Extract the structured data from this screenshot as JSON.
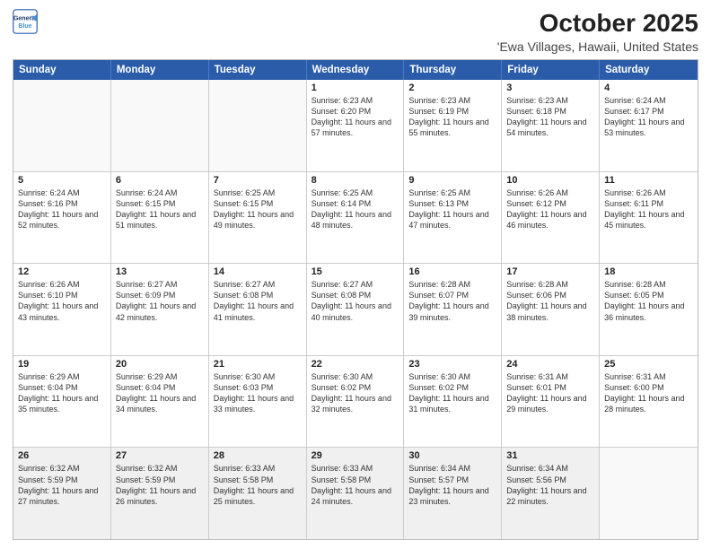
{
  "header": {
    "logo_line1": "General",
    "logo_line2": "Blue",
    "month": "October 2025",
    "location": "'Ewa Villages, Hawaii, United States"
  },
  "weekdays": [
    "Sunday",
    "Monday",
    "Tuesday",
    "Wednesday",
    "Thursday",
    "Friday",
    "Saturday"
  ],
  "rows": [
    [
      {
        "day": "",
        "info": ""
      },
      {
        "day": "",
        "info": ""
      },
      {
        "day": "",
        "info": ""
      },
      {
        "day": "1",
        "info": "Sunrise: 6:23 AM\nSunset: 6:20 PM\nDaylight: 11 hours and 57 minutes."
      },
      {
        "day": "2",
        "info": "Sunrise: 6:23 AM\nSunset: 6:19 PM\nDaylight: 11 hours and 55 minutes."
      },
      {
        "day": "3",
        "info": "Sunrise: 6:23 AM\nSunset: 6:18 PM\nDaylight: 11 hours and 54 minutes."
      },
      {
        "day": "4",
        "info": "Sunrise: 6:24 AM\nSunset: 6:17 PM\nDaylight: 11 hours and 53 minutes."
      }
    ],
    [
      {
        "day": "5",
        "info": "Sunrise: 6:24 AM\nSunset: 6:16 PM\nDaylight: 11 hours and 52 minutes."
      },
      {
        "day": "6",
        "info": "Sunrise: 6:24 AM\nSunset: 6:15 PM\nDaylight: 11 hours and 51 minutes."
      },
      {
        "day": "7",
        "info": "Sunrise: 6:25 AM\nSunset: 6:15 PM\nDaylight: 11 hours and 49 minutes."
      },
      {
        "day": "8",
        "info": "Sunrise: 6:25 AM\nSunset: 6:14 PM\nDaylight: 11 hours and 48 minutes."
      },
      {
        "day": "9",
        "info": "Sunrise: 6:25 AM\nSunset: 6:13 PM\nDaylight: 11 hours and 47 minutes."
      },
      {
        "day": "10",
        "info": "Sunrise: 6:26 AM\nSunset: 6:12 PM\nDaylight: 11 hours and 46 minutes."
      },
      {
        "day": "11",
        "info": "Sunrise: 6:26 AM\nSunset: 6:11 PM\nDaylight: 11 hours and 45 minutes."
      }
    ],
    [
      {
        "day": "12",
        "info": "Sunrise: 6:26 AM\nSunset: 6:10 PM\nDaylight: 11 hours and 43 minutes."
      },
      {
        "day": "13",
        "info": "Sunrise: 6:27 AM\nSunset: 6:09 PM\nDaylight: 11 hours and 42 minutes."
      },
      {
        "day": "14",
        "info": "Sunrise: 6:27 AM\nSunset: 6:08 PM\nDaylight: 11 hours and 41 minutes."
      },
      {
        "day": "15",
        "info": "Sunrise: 6:27 AM\nSunset: 6:08 PM\nDaylight: 11 hours and 40 minutes."
      },
      {
        "day": "16",
        "info": "Sunrise: 6:28 AM\nSunset: 6:07 PM\nDaylight: 11 hours and 39 minutes."
      },
      {
        "day": "17",
        "info": "Sunrise: 6:28 AM\nSunset: 6:06 PM\nDaylight: 11 hours and 38 minutes."
      },
      {
        "day": "18",
        "info": "Sunrise: 6:28 AM\nSunset: 6:05 PM\nDaylight: 11 hours and 36 minutes."
      }
    ],
    [
      {
        "day": "19",
        "info": "Sunrise: 6:29 AM\nSunset: 6:04 PM\nDaylight: 11 hours and 35 minutes."
      },
      {
        "day": "20",
        "info": "Sunrise: 6:29 AM\nSunset: 6:04 PM\nDaylight: 11 hours and 34 minutes."
      },
      {
        "day": "21",
        "info": "Sunrise: 6:30 AM\nSunset: 6:03 PM\nDaylight: 11 hours and 33 minutes."
      },
      {
        "day": "22",
        "info": "Sunrise: 6:30 AM\nSunset: 6:02 PM\nDaylight: 11 hours and 32 minutes."
      },
      {
        "day": "23",
        "info": "Sunrise: 6:30 AM\nSunset: 6:02 PM\nDaylight: 11 hours and 31 minutes."
      },
      {
        "day": "24",
        "info": "Sunrise: 6:31 AM\nSunset: 6:01 PM\nDaylight: 11 hours and 29 minutes."
      },
      {
        "day": "25",
        "info": "Sunrise: 6:31 AM\nSunset: 6:00 PM\nDaylight: 11 hours and 28 minutes."
      }
    ],
    [
      {
        "day": "26",
        "info": "Sunrise: 6:32 AM\nSunset: 5:59 PM\nDaylight: 11 hours and 27 minutes."
      },
      {
        "day": "27",
        "info": "Sunrise: 6:32 AM\nSunset: 5:59 PM\nDaylight: 11 hours and 26 minutes."
      },
      {
        "day": "28",
        "info": "Sunrise: 6:33 AM\nSunset: 5:58 PM\nDaylight: 11 hours and 25 minutes."
      },
      {
        "day": "29",
        "info": "Sunrise: 6:33 AM\nSunset: 5:58 PM\nDaylight: 11 hours and 24 minutes."
      },
      {
        "day": "30",
        "info": "Sunrise: 6:34 AM\nSunset: 5:57 PM\nDaylight: 11 hours and 23 minutes."
      },
      {
        "day": "31",
        "info": "Sunrise: 6:34 AM\nSunset: 5:56 PM\nDaylight: 11 hours and 22 minutes."
      },
      {
        "day": "",
        "info": ""
      }
    ]
  ]
}
